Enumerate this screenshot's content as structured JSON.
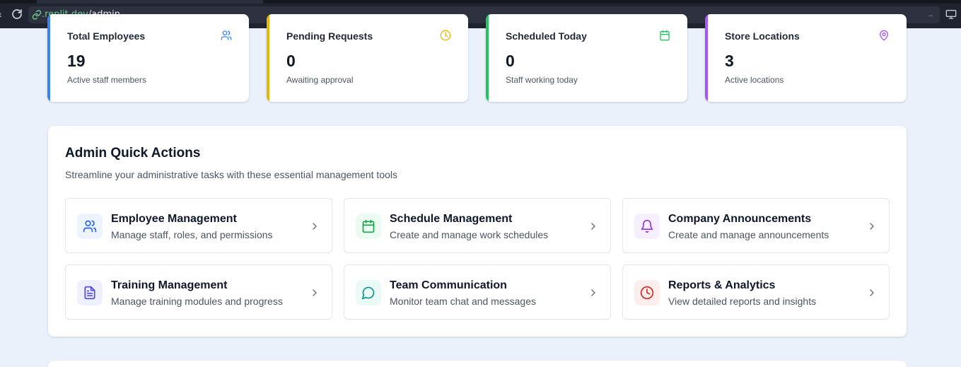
{
  "browser": {
    "url_domain": ".replit.dev",
    "url_path": "/admin"
  },
  "stats": [
    {
      "title": "Total Employees",
      "value": "19",
      "desc": "Active staff members",
      "color": "#3b82f6",
      "icon": "users-icon"
    },
    {
      "title": "Pending Requests",
      "value": "0",
      "desc": "Awaiting approval",
      "color": "#eab308",
      "icon": "clock-icon"
    },
    {
      "title": "Scheduled Today",
      "value": "0",
      "desc": "Staff working today",
      "color": "#22c55e",
      "icon": "calendar-icon"
    },
    {
      "title": "Store Locations",
      "value": "3",
      "desc": "Active locations",
      "color": "#a855f7",
      "icon": "map-pin-icon"
    }
  ],
  "quick_actions": {
    "title": "Admin Quick Actions",
    "subtitle": "Streamline your administrative tasks with these essential management tools",
    "items": [
      {
        "title": "Employee Management",
        "desc": "Manage staff, roles, and permissions",
        "icon": "users-icon",
        "color": "#2563eb",
        "bg": "#eef4ff"
      },
      {
        "title": "Schedule Management",
        "desc": "Create and manage work schedules",
        "icon": "calendar-icon",
        "color": "#16a34a",
        "bg": "#ecfbf1"
      },
      {
        "title": "Company Announcements",
        "desc": "Create and manage announcements",
        "icon": "bell-icon",
        "color": "#9333ea",
        "bg": "#f6efff"
      },
      {
        "title": "Training Management",
        "desc": "Manage training modules and progress",
        "icon": "document-icon",
        "color": "#4f46e5",
        "bg": "#eef0ff"
      },
      {
        "title": "Team Communication",
        "desc": "Monitor team chat and messages",
        "icon": "message-icon",
        "color": "#0d9488",
        "bg": "#eafaf7"
      },
      {
        "title": "Reports & Analytics",
        "desc": "View detailed reports and insights",
        "icon": "clock-icon",
        "color": "#dc2626",
        "bg": "#fdeeee"
      }
    ]
  }
}
